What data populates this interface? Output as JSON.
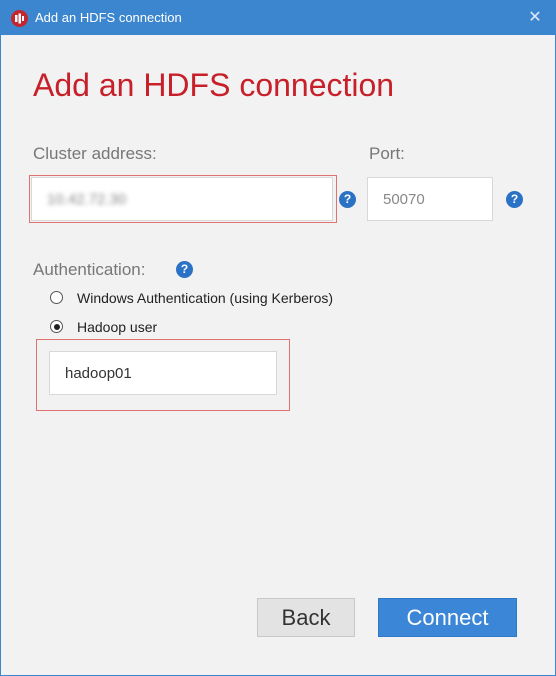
{
  "window": {
    "title": "Add an HDFS connection",
    "close_glyph": "✕",
    "accent_color": "#3c86cf"
  },
  "heading": "Add an HDFS connection",
  "cluster": {
    "label": "Cluster address:",
    "value": "10.42.72.30",
    "help_glyph": "?"
  },
  "port": {
    "label": "Port:",
    "value": "50070",
    "help_glyph": "?"
  },
  "auth": {
    "label": "Authentication:",
    "help_glyph": "?",
    "options": [
      {
        "label": "Windows Authentication (using Kerberos)",
        "selected": false
      },
      {
        "label": "Hadoop user",
        "selected": true
      }
    ],
    "hadoop_user": "hadoop01"
  },
  "buttons": {
    "back": "Back",
    "connect": "Connect"
  },
  "colors": {
    "heading": "#c8202a",
    "primary_button": "#3b86d6",
    "highlight_border": "#e07272"
  },
  "icons": {
    "app": "power-bi-logo-icon",
    "help": "question-circle-icon",
    "close": "close-icon"
  }
}
